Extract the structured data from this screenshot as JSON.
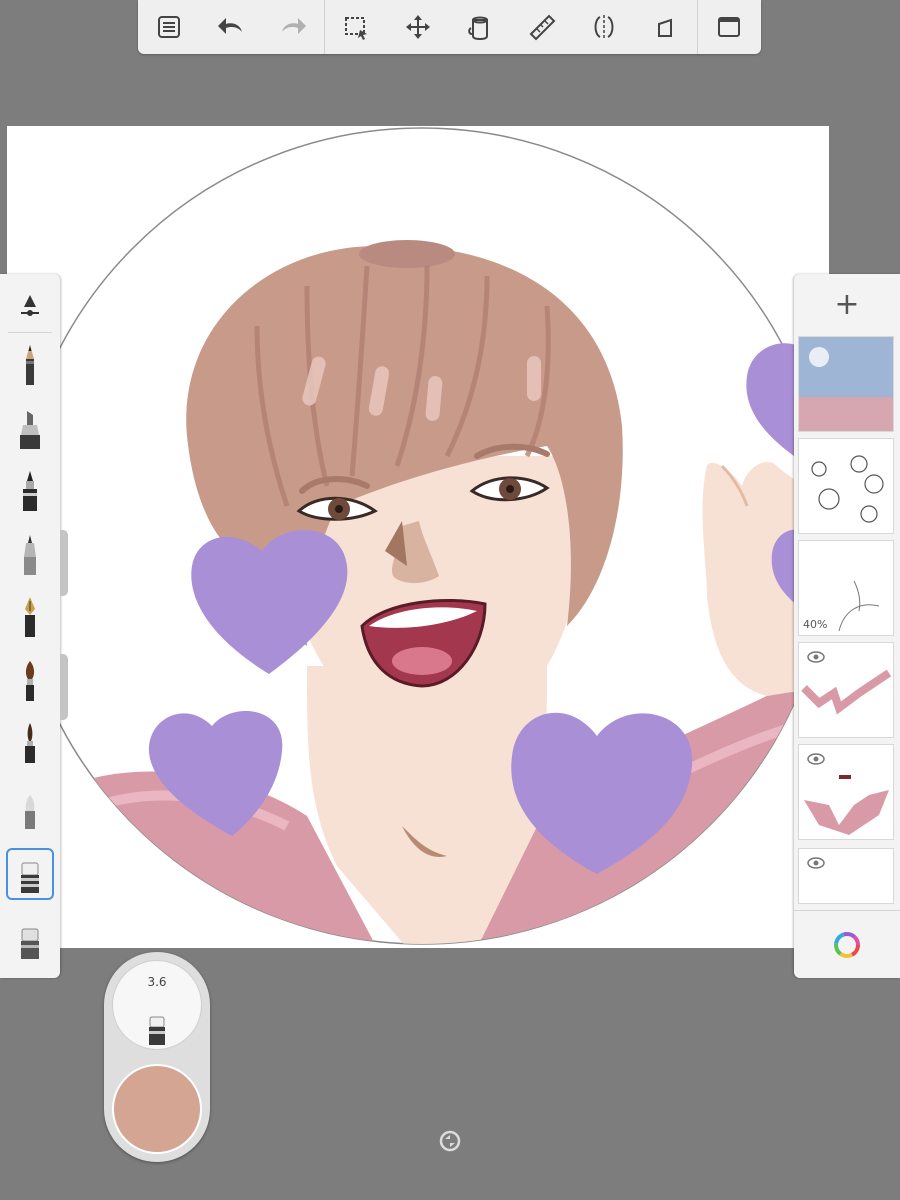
{
  "app": {
    "toolbar": {
      "buttons": [
        {
          "name": "lagoon-menu-icon"
        },
        {
          "name": "undo-icon"
        },
        {
          "name": "redo-icon"
        },
        {
          "name": "selection-icon"
        },
        {
          "name": "transform-icon"
        },
        {
          "name": "fill-bucket-icon"
        },
        {
          "name": "ruler-icon"
        },
        {
          "name": "symmetry-icon"
        },
        {
          "name": "perspective-icon"
        },
        {
          "name": "fullscreen-icon"
        }
      ]
    },
    "brush_palette": {
      "brushes": [
        {
          "name": "pencil-brush",
          "active": false
        },
        {
          "name": "marker-brush",
          "active": false
        },
        {
          "name": "pen-brush",
          "active": false
        },
        {
          "name": "airbrush",
          "active": false
        },
        {
          "name": "fountain-pen-brush",
          "active": false
        },
        {
          "name": "paintbrush",
          "active": false
        },
        {
          "name": "ink-brush",
          "active": false
        },
        {
          "name": "blender-brush",
          "active": false
        },
        {
          "name": "eraser-brush",
          "active": true
        },
        {
          "name": "hard-eraser-brush",
          "active": false
        }
      ]
    },
    "brush_puck": {
      "size": "3.6",
      "color": "#d3a592"
    },
    "layers": {
      "items": [
        {
          "name": "layer-1",
          "opacity": "",
          "visible": true
        },
        {
          "name": "layer-2",
          "opacity": "",
          "visible": true
        },
        {
          "name": "layer-3",
          "opacity": "40%",
          "visible": true
        },
        {
          "name": "layer-4",
          "opacity": "",
          "visible": true
        },
        {
          "name": "layer-5",
          "opacity": "",
          "visible": true
        },
        {
          "name": "layer-6",
          "opacity": "",
          "visible": true
        }
      ]
    },
    "colors": {
      "heart": "#a98fd6",
      "hair": "#c89a8a",
      "skin": "#f7e0d4",
      "shirt": "#d99aa7",
      "accent": "#4a90e2"
    }
  }
}
